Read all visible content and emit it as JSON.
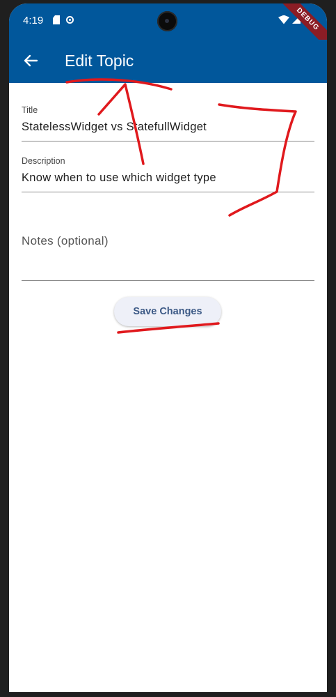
{
  "status_bar": {
    "time": "4:19",
    "debug_label": "DEBUG"
  },
  "app_bar": {
    "title": "Edit Topic",
    "back_icon": "arrow-back-icon"
  },
  "form": {
    "title": {
      "label": "Title",
      "value": "StatelessWidget vs StatefullWidget"
    },
    "description": {
      "label": "Description",
      "value": "Know when to use which widget type"
    },
    "notes": {
      "label": "Notes (optional)",
      "value": ""
    },
    "save_label": "Save Changes"
  },
  "colors": {
    "app_bar": "#01579b",
    "annotation": "#e0191d",
    "button_text": "#3d5a86"
  }
}
